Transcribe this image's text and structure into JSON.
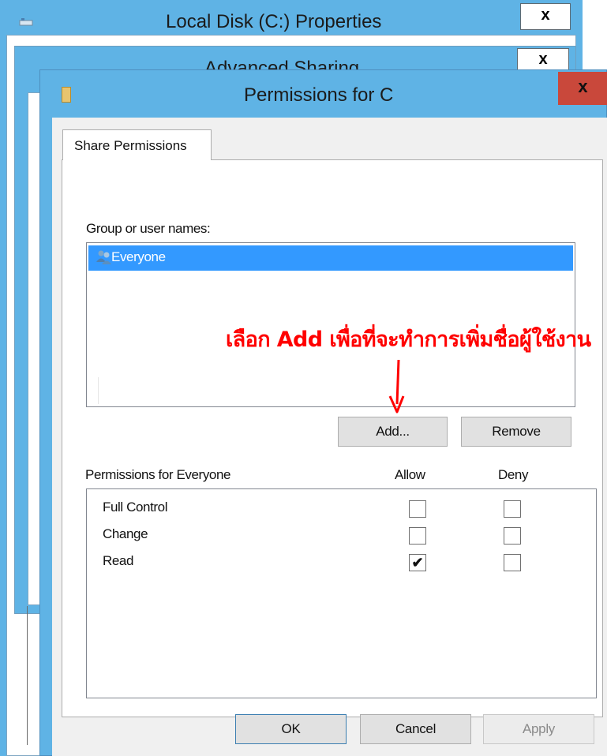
{
  "background_windows": {
    "properties_title": "Local Disk (C:) Properties",
    "advanced_sharing_title": "Advanced Sharing",
    "close_glyph": "x"
  },
  "dialog": {
    "title": "Permissions for C",
    "close_glyph": "x",
    "tab_label": "Share Permissions",
    "group_label": "Group or user names:",
    "users": [
      {
        "name": "Everyone",
        "icon": "user-group-icon",
        "selected": true
      }
    ],
    "annotation": "เลือก Add เพื่อที่จะทำการเพิ่มชื่อผู้ใช้งาน",
    "annotation_color": "#ff0000",
    "add_button": "Add...",
    "remove_button": "Remove",
    "permissions_label": "Permissions for Everyone",
    "allow_header": "Allow",
    "deny_header": "Deny",
    "permissions": [
      {
        "name": "Full Control",
        "allow": false,
        "deny": false
      },
      {
        "name": "Change",
        "allow": false,
        "deny": false
      },
      {
        "name": "Read",
        "allow": true,
        "deny": false
      }
    ],
    "ok_button": "OK",
    "cancel_button": "Cancel",
    "apply_button": "Apply",
    "accent_color": "#5fb3e5",
    "selection_color": "#3399ff",
    "close_color": "#c9483b"
  }
}
